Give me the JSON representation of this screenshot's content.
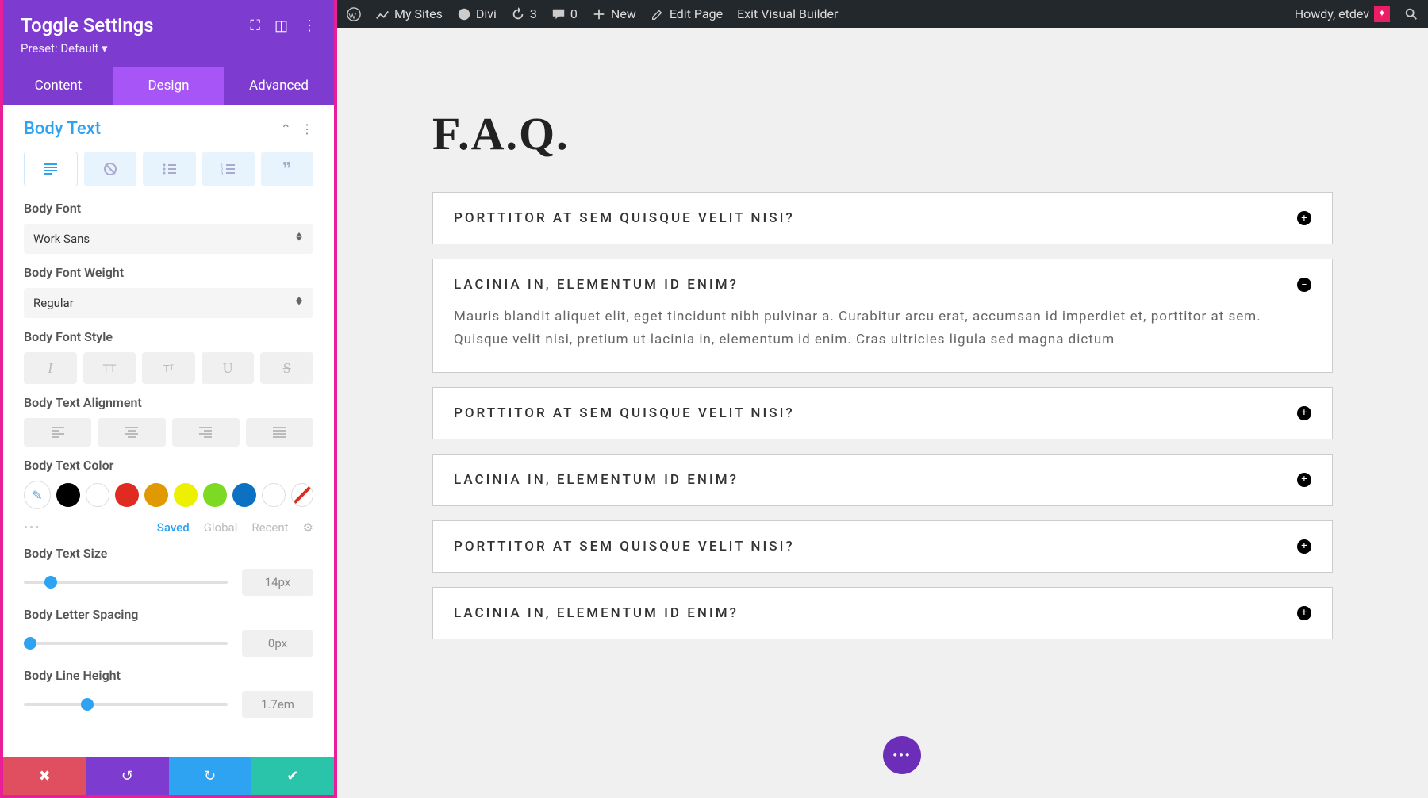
{
  "adminBar": {
    "mySites": "My Sites",
    "divi": "Divi",
    "updates": "3",
    "comments": "0",
    "new": "New",
    "editPage": "Edit Page",
    "exit": "Exit Visual Builder",
    "howdy": "Howdy, etdev"
  },
  "sidebar": {
    "title": "Toggle Settings",
    "preset": "Preset: Default ▾",
    "tabs": {
      "content": "Content",
      "design": "Design",
      "advanced": "Advanced"
    },
    "section": "Body Text",
    "labels": {
      "font": "Body Font",
      "weight": "Body Font Weight",
      "style": "Body Font Style",
      "align": "Body Text Alignment",
      "color": "Body Text Color",
      "size": "Body Text Size",
      "spacing": "Body Letter Spacing",
      "lineHeight": "Body Line Height"
    },
    "values": {
      "font": "Work Sans",
      "weight": "Regular",
      "size": "14px",
      "spacing": "0px",
      "lineHeight": "1.7em"
    },
    "colorTabs": {
      "saved": "Saved",
      "global": "Global",
      "recent": "Recent"
    },
    "colors": [
      "#000000",
      "#ffffff",
      "#e02b20",
      "#e09900",
      "#edf000",
      "#7cda24",
      "#0c71c3",
      "#ffffff"
    ]
  },
  "page": {
    "title": "F.A.Q.",
    "toggles": [
      {
        "title": "PORTTITOR AT SEM QUISQUE VELIT NISI?",
        "open": false
      },
      {
        "title": "LACINIA IN, ELEMENTUM ID ENIM?",
        "open": true,
        "body": "Mauris blandit aliquet elit, eget tincidunt nibh pulvinar a. Curabitur arcu erat, accumsan id imperdiet et, porttitor at sem. Quisque velit nisi, pretium ut lacinia in, elementum id enim. Cras ultricies ligula sed magna dictum"
      },
      {
        "title": "PORTTITOR AT SEM QUISQUE VELIT NISI?",
        "open": false
      },
      {
        "title": "LACINIA IN, ELEMENTUM ID ENIM?",
        "open": false
      },
      {
        "title": "PORTTITOR AT SEM QUISQUE VELIT NISI?",
        "open": false
      },
      {
        "title": "LACINIA IN, ELEMENTUM ID ENIM?",
        "open": false
      }
    ]
  }
}
